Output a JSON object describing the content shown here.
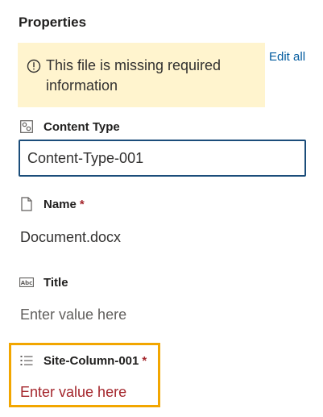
{
  "panel": {
    "heading": "Properties",
    "edit_all_label": "Edit all"
  },
  "warning": {
    "message": "This file is missing required information",
    "icon": "info-icon"
  },
  "fields": {
    "content_type": {
      "label": "Content Type",
      "icon": "content-type-icon",
      "value": "Content-Type-001"
    },
    "name": {
      "label": "Name",
      "required_marker": "*",
      "icon": "document-icon",
      "value": "Document.docx"
    },
    "title": {
      "label": "Title",
      "icon": "text-field-icon",
      "placeholder": "Enter value here"
    },
    "site_column": {
      "label": "Site-Column-001",
      "required_marker": "*",
      "icon": "list-field-icon",
      "placeholder": "Enter value here"
    }
  },
  "colors": {
    "warning_bg": "#fff4ce",
    "link": "#005a9e",
    "required": "#a4262c",
    "focus_border": "#1b4d7a",
    "highlight_border": "#f2a600"
  }
}
